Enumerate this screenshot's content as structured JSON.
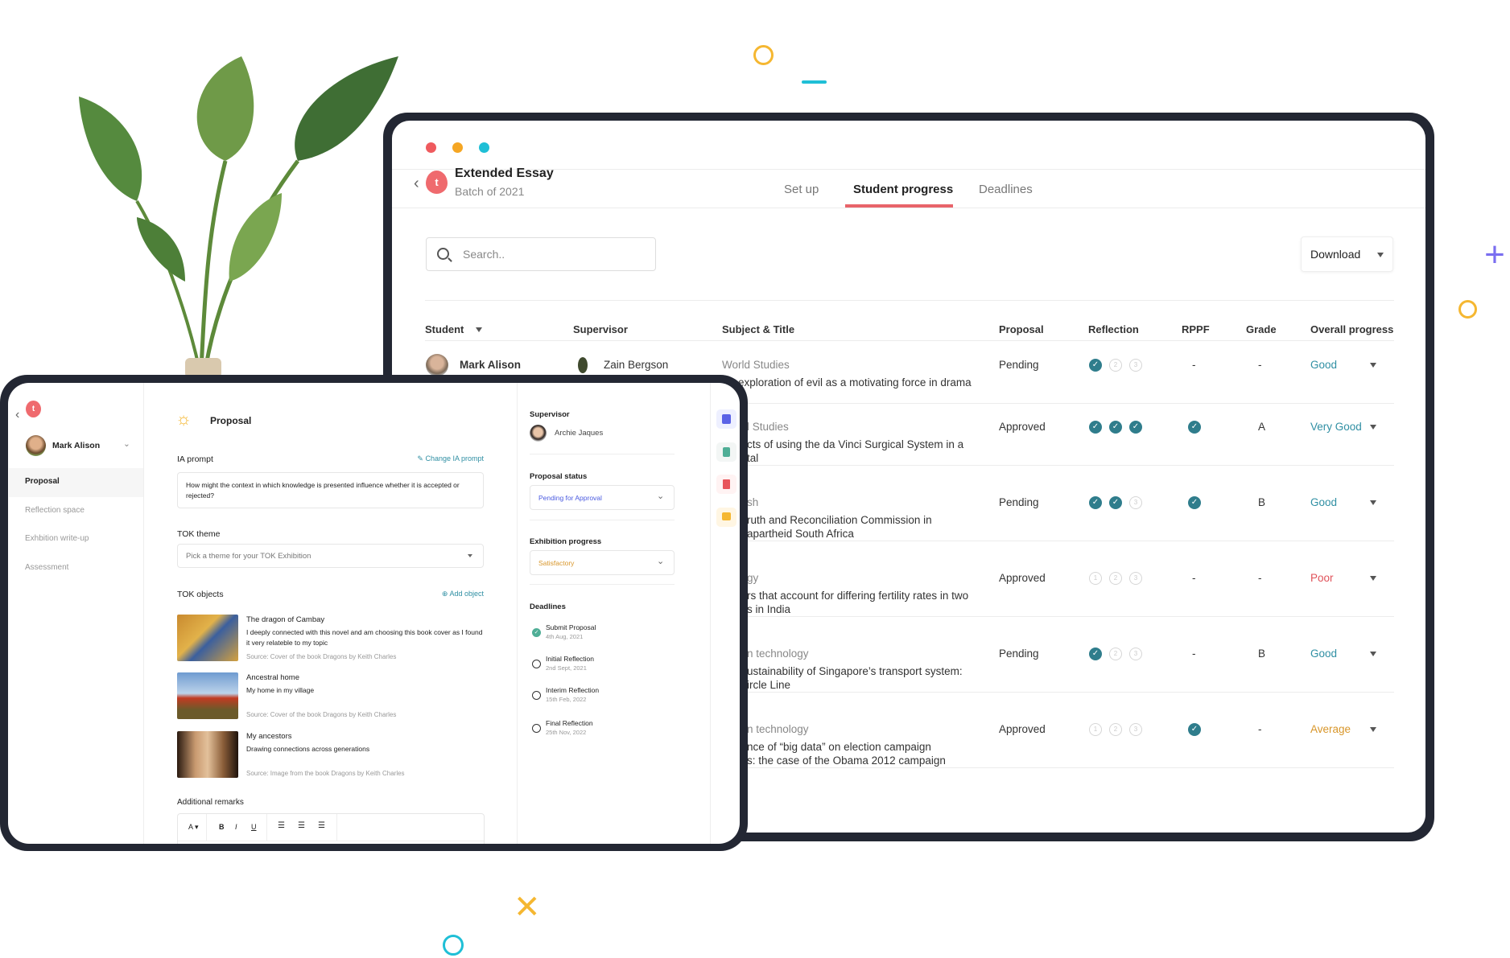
{
  "window": {
    "dots": [
      "#ef5a5e",
      "#f5a623",
      "#1fbfd6"
    ]
  },
  "header": {
    "title": "Extended Essay",
    "subtitle": "Batch of 2021",
    "logo_letter": "t"
  },
  "tabs": [
    {
      "label": "Set up",
      "active": false
    },
    {
      "label": "Student progress",
      "active": true
    },
    {
      "label": "Deadlines",
      "active": false
    }
  ],
  "search": {
    "placeholder": "Search.."
  },
  "download_label": "Download",
  "table": {
    "headers": {
      "student": "Student",
      "supervisor": "Supervisor",
      "subject": "Subject & Title",
      "proposal": "Proposal",
      "reflection": "Reflection",
      "rppf": "RPPF",
      "grade": "Grade",
      "overall": "Overall progress"
    },
    "rows": [
      {
        "student": "Mark Alison",
        "supervisor": "Zain Bergson",
        "subject": "World Studies",
        "title": [
          "exploration of evil as a motivating force in drama"
        ],
        "proposal": "Pending",
        "reflection": [
          true,
          false,
          false
        ],
        "rppf": "-",
        "grade": "-",
        "overall": "Good",
        "overall_color": "#2f8fa3"
      },
      {
        "subject": "l Studies",
        "title": [
          "cts of using the da Vinci Surgical System in a",
          "tal"
        ],
        "proposal": "Approved",
        "reflection": [
          true,
          true,
          true
        ],
        "rppf": true,
        "grade": "A",
        "overall": "Very Good",
        "overall_color": "#2f8fa3"
      },
      {
        "subject": "sh",
        "title": [
          "ruth and Reconciliation Commission in",
          "apartheid South Africa"
        ],
        "proposal": "Pending",
        "reflection": [
          true,
          true,
          false
        ],
        "rppf": true,
        "grade": "B",
        "overall": "Good",
        "overall_color": "#2f8fa3"
      },
      {
        "subject": "gy",
        "title": [
          "rs that account for differing fertility rates in two",
          "s in India"
        ],
        "proposal": "Approved",
        "reflection": [
          false,
          false,
          false
        ],
        "rppf": "-",
        "grade": "-",
        "overall": "Poor",
        "overall_color": "#e0525a"
      },
      {
        "subject": "n technology",
        "title": [
          "ustainability of Singapore’s transport system:",
          "ircle Line"
        ],
        "proposal": "Pending",
        "reflection": [
          true,
          false,
          false
        ],
        "rppf": "-",
        "grade": "B",
        "overall": "Good",
        "overall_color": "#2f8fa3"
      },
      {
        "subject": "n technology",
        "title": [
          "nce of “big data” on election campaign",
          "s: the case of the Obama 2012 campaign"
        ],
        "proposal": "Approved",
        "reflection": [
          false,
          false,
          false
        ],
        "rppf": true,
        "grade": "-",
        "overall": "Average",
        "overall_color": "#d8962a"
      }
    ]
  },
  "student_view": {
    "user": "Mark Alison",
    "nav": [
      "Proposal",
      "Reflection space",
      "Exhbition write-up",
      "Assessment"
    ],
    "section_title": "Proposal",
    "ia_prompt": {
      "label": "IA prompt",
      "action": "Change IA prompt",
      "value": "How might the context in which knowledge is presented influence whether it is accepted or rejected?"
    },
    "tok_theme": {
      "label": "TOK theme",
      "placeholder": "Pick a theme for your TOK Exhibition"
    },
    "tok_objects": {
      "label": "TOK objects",
      "action": "Add object",
      "items": [
        {
          "title": "The dragon of Cambay",
          "desc": "I deeply connected with this novel and am choosing this book cover as I found it very relateble to my topic",
          "source": "Source: Cover of the book Dragons by Keith Charles"
        },
        {
          "title": "Ancestral home",
          "desc": "My home in my village",
          "source": "Source: Cover of the book Dragons by Keith Charles"
        },
        {
          "title": "My ancestors",
          "desc": "Drawing connections across generations",
          "source": "Source: Image from the book Dragons by Keith Charles"
        }
      ]
    },
    "remarks": {
      "label": "Additional remarks",
      "toolbar": [
        "A ▾",
        "B",
        "I",
        "U"
      ]
    },
    "supervisor": {
      "label": "Supervisor",
      "name": "Archie Jaques"
    },
    "proposal_status": {
      "label": "Proposal status",
      "value": "Pending for Approval",
      "color": "#4a5ae0"
    },
    "exhibition_progress": {
      "label": "Exhibition progress",
      "value": "Satisfactory",
      "color": "#d8962a"
    },
    "deadlines": {
      "label": "Deadlines",
      "items": [
        {
          "title": "Submit Proposal",
          "date": "4th Aug, 2021",
          "done": true
        },
        {
          "title": "Initial Reflection",
          "date": "2nd Sept, 2021",
          "done": false
        },
        {
          "title": "Interim Reflection",
          "date": "15th Feb, 2022",
          "done": false
        },
        {
          "title": "Final Reflection",
          "date": "25th Nov, 2022",
          "done": false
        }
      ]
    }
  }
}
